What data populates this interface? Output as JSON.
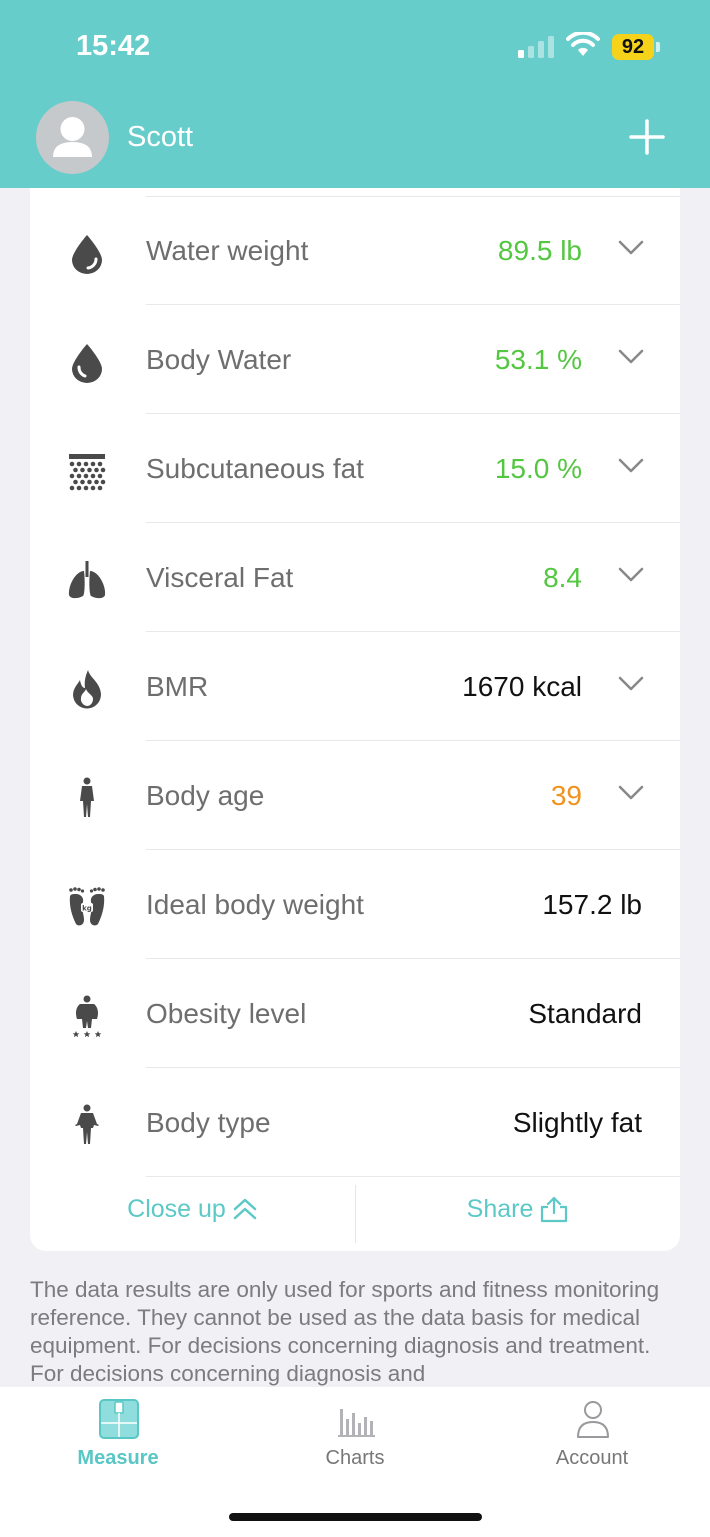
{
  "status": {
    "time": "15:42",
    "battery": "92"
  },
  "header": {
    "user_name": "Scott"
  },
  "metrics": [
    {
      "label": "Water weight",
      "value": "89.5 lb",
      "icon": "water-drop-icon"
    },
    {
      "label": "Body Water",
      "value": "53.1 %",
      "icon": "water-drop-icon"
    },
    {
      "label": "Subcutaneous fat",
      "value": "15.0 %",
      "icon": "subcutaneous-fat-icon"
    },
    {
      "label": "Visceral Fat",
      "value": "8.4",
      "icon": "lungs-icon"
    },
    {
      "label": "BMR",
      "value": "1670 kcal",
      "icon": "flame-icon"
    },
    {
      "label": "Body age",
      "value": "39",
      "icon": "person-icon"
    },
    {
      "label": "Ideal body weight",
      "value": "157.2 lb",
      "icon": "feet-kg-icon"
    },
    {
      "label": "Obesity level",
      "value": "Standard",
      "icon": "obesity-person-icon"
    },
    {
      "label": "Body type",
      "value": "Slightly fat",
      "icon": "body-type-icon"
    }
  ],
  "actions": {
    "close_up": "Close up",
    "share": "Share"
  },
  "disclaimer": "The data results are only used for sports and fitness monitoring reference. They cannot be used as the data basis for medical equipment. For decisions concerning diagnosis and treatment. For decisions concerning diagnosis and",
  "tabs": [
    {
      "label": "Measure",
      "active": true
    },
    {
      "label": "Charts",
      "active": false
    },
    {
      "label": "Account",
      "active": false
    }
  ],
  "colors": {
    "header": "#67cdcb",
    "accent": "#58c7c5",
    "good": "#53c740",
    "warning": "#f0931e"
  }
}
